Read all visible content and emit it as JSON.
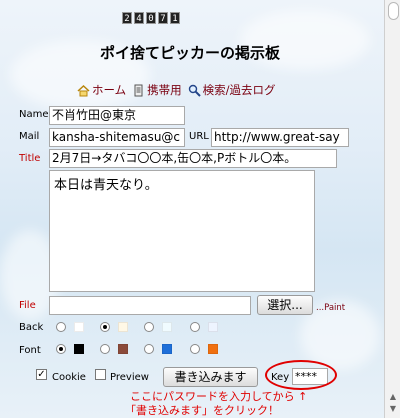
{
  "counter": {
    "digits": [
      "2",
      "4",
      "0",
      "7",
      "1"
    ]
  },
  "board": {
    "title": "ポイ捨てピッカーの掲示板"
  },
  "nav": [
    {
      "label": "ホーム",
      "icon": "home-icon"
    },
    {
      "label": "携帯用",
      "icon": "mobile-icon"
    },
    {
      "label": "検索/過去ログ",
      "icon": "search-icon"
    }
  ],
  "form": {
    "name_label": "Name",
    "name_value": "不肖竹田@東京",
    "mail_label": "Mail",
    "mail_value": "kansha-shitemasu@c",
    "url_label": "URL",
    "url_value": "http://www.great-say",
    "title_label": "Title",
    "title_value": "2月7日→タバコ〇〇本,缶〇本,Pボトル〇本。",
    "body_value": "本日は青天なり。",
    "file_label": "File",
    "browse_label": "選択...",
    "paint_label": "...Paint",
    "back_label": "Back",
    "font_label": "Font",
    "back_colors": [
      "#ffffff",
      "#fff8e6",
      "#f0fbff",
      "#eef4ff"
    ],
    "font_colors": [
      "#000000",
      "#8b4a3a",
      "#1e6fd9",
      "#f07010"
    ],
    "cookie_label": "Cookie",
    "preview_label": "Preview",
    "submit_label": "書き込みます",
    "key_label": "Key",
    "key_value": "****"
  },
  "annotation": {
    "line1": "ここにパスワードを入力してから ↑",
    "line2": "「書き込みます」をクリック！"
  }
}
